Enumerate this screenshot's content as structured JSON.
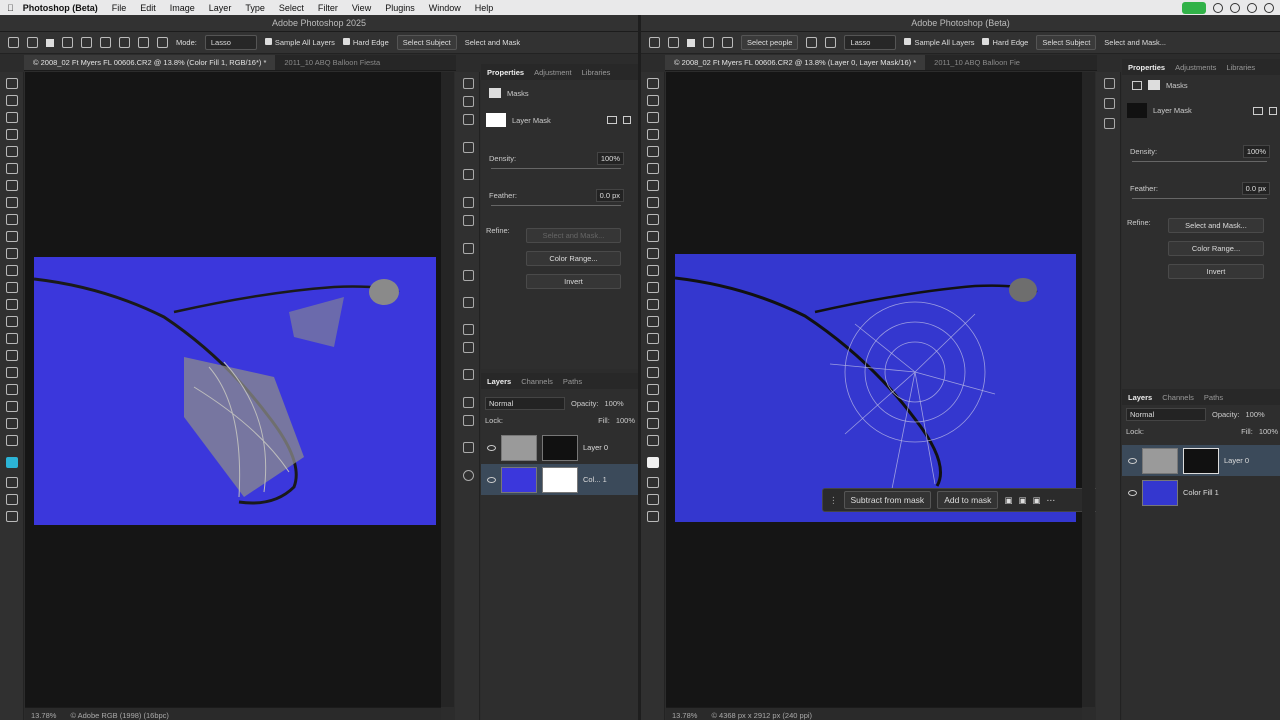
{
  "menubar": {
    "app": "Photoshop (Beta)",
    "items": [
      "File",
      "Edit",
      "Image",
      "Layer",
      "Type",
      "Select",
      "Filter",
      "View",
      "Plugins",
      "Window",
      "Help"
    ]
  },
  "left": {
    "title": "Adobe Photoshop 2025",
    "options": {
      "mode_label": "Mode:",
      "mode_value": "Lasso",
      "sample_all": "Sample All Layers",
      "hard_edge": "Hard Edge",
      "select_subject": "Select Subject",
      "select_mask": "Select and Mask"
    },
    "tabs": [
      "© 2008_02 Ft Myers FL 00606.CR2 @ 13.8% (Color Fill 1, RGB/16*) *",
      "2011_10 ABQ Balloon Fiesta"
    ],
    "status": {
      "zoom": "13.78%",
      "info": "© Adobe RGB (1998) (16bpc)"
    },
    "properties": {
      "tabs": [
        "Properties",
        "Adjustment",
        "Libraries"
      ],
      "masks": "Masks",
      "layer_mask": "Layer Mask",
      "density_label": "Density:",
      "density": "100%",
      "feather_label": "Feather:",
      "feather": "0.0 px",
      "refine": "Refine:",
      "select_mask": "Select and Mask...",
      "color_range": "Color Range...",
      "invert": "Invert"
    },
    "layers": {
      "tabs": [
        "Layers",
        "Channels",
        "Paths"
      ],
      "blend": "Normal",
      "opacity_label": "Opacity:",
      "opacity": "100%",
      "lock": "Lock:",
      "fill_label": "Fill:",
      "fill": "100%",
      "rows": [
        {
          "name": "Layer 0"
        },
        {
          "name": "Col... 1"
        }
      ]
    }
  },
  "right": {
    "title": "Adobe Photoshop (Beta)",
    "options": {
      "select_people": "Select people",
      "mode_value": "Lasso",
      "sample_all": "Sample All Layers",
      "hard_edge": "Hard Edge",
      "select_subject": "Select Subject",
      "select_mask": "Select and Mask..."
    },
    "tabs": [
      "© 2008_02 Ft Myers FL 00606.CR2 @ 13.8% (Layer 0, Layer Mask/16) *",
      "2011_10 ABQ Balloon Fie"
    ],
    "status": {
      "zoom": "13.78%",
      "info": "© 4368 px x 2912 px (240 ppi)"
    },
    "floating": {
      "subtract": "Subtract from mask",
      "add": "Add to mask"
    },
    "properties": {
      "tabs": [
        "Properties",
        "Adjustments",
        "Libraries"
      ],
      "masks": "Masks",
      "layer_mask": "Layer Mask",
      "density_label": "Density:",
      "density": "100%",
      "feather_label": "Feather:",
      "feather": "0.0 px",
      "refine": "Refine:",
      "select_mask": "Select and Mask...",
      "color_range": "Color Range...",
      "invert": "Invert"
    },
    "layers": {
      "tabs": [
        "Layers",
        "Channels",
        "Paths"
      ],
      "blend": "Normal",
      "opacity_label": "Opacity:",
      "opacity": "100%",
      "lock": "Lock:",
      "fill_label": "Fill:",
      "fill": "100%",
      "rows": [
        {
          "name": "Layer 0"
        },
        {
          "name": "Color Fill 1"
        }
      ]
    }
  }
}
